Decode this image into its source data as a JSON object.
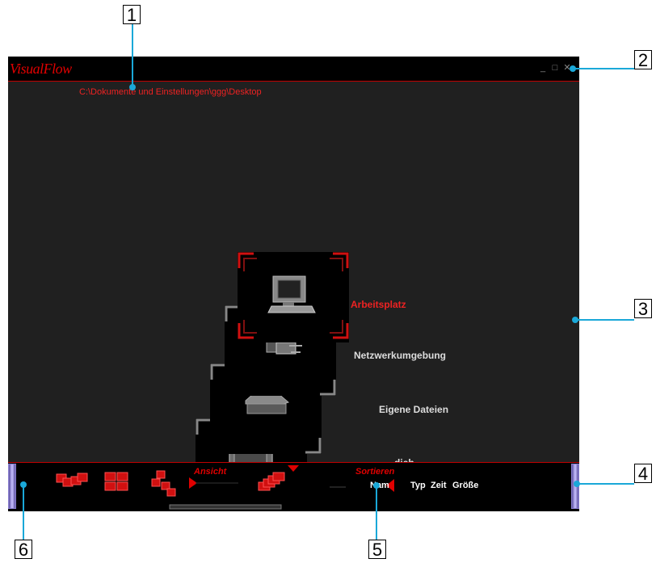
{
  "window": {
    "app_title": "VisualFlow",
    "path": "C:\\Dokumente und Einstellungen\\ggg\\Desktop",
    "controls": {
      "minimize": "_",
      "maximize": "□",
      "close": "✕"
    }
  },
  "items": [
    {
      "label": "Arbeitsplatz",
      "icon": "computer-icon",
      "selected": true
    },
    {
      "label": "Netzwerkumgebung",
      "icon": "network-icon",
      "selected": false
    },
    {
      "label": "Eigene Dateien",
      "icon": "documents-folder-icon",
      "selected": false
    },
    {
      "label": "dich",
      "icon": "folder-icon",
      "selected": false
    }
  ],
  "toolbar": {
    "view_label": "Ansicht",
    "sort_label": "Sortieren",
    "sort_options": [
      "Nam",
      "Typ",
      "Zeit",
      "Größe"
    ],
    "view_icons": [
      "flow-view-icon",
      "grid-view-icon",
      "stack-view-icon",
      "cascade-view-icon"
    ]
  },
  "callouts": [
    "1",
    "2",
    "3",
    "4",
    "5",
    "6"
  ],
  "colors": {
    "accent": "#e00000",
    "background": "#202020",
    "bar": "#000000",
    "leader": "#1aa8d8"
  }
}
